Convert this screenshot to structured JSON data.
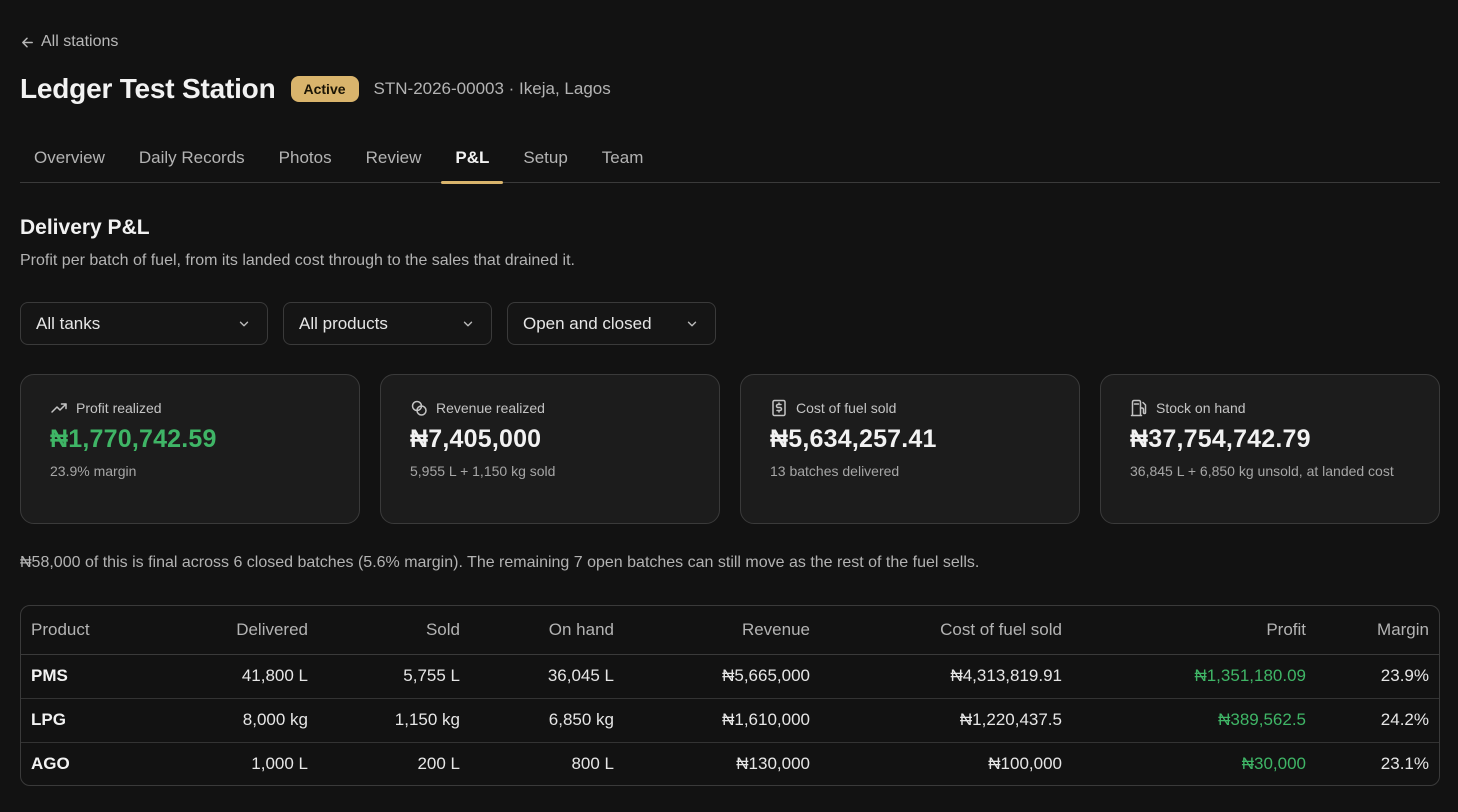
{
  "nav": {
    "back_label": "All stations"
  },
  "station": {
    "name": "Ledger Test Station",
    "status": "Active",
    "meta": "STN-2026-00003 · Ikeja, Lagos"
  },
  "tabs": [
    {
      "label": "Overview",
      "active": false
    },
    {
      "label": "Daily Records",
      "active": false
    },
    {
      "label": "Photos",
      "active": false
    },
    {
      "label": "Review",
      "active": false
    },
    {
      "label": "P&L",
      "active": true
    },
    {
      "label": "Setup",
      "active": false
    },
    {
      "label": "Team",
      "active": false
    }
  ],
  "section": {
    "title": "Delivery P&L",
    "description": "Profit per batch of fuel, from its landed cost through to the sales that drained it."
  },
  "filters": {
    "tank": "All tanks",
    "product": "All products",
    "status": "Open and closed"
  },
  "cards": [
    {
      "label": "Profit realized",
      "icon": "trending-up-icon",
      "value": "₦1,770,742.59",
      "sub": "23.9% margin",
      "positive": true
    },
    {
      "label": "Revenue realized",
      "icon": "coins-icon",
      "value": "₦7,405,000",
      "sub": "5,955 L + 1,150 kg sold",
      "positive": false
    },
    {
      "label": "Cost of fuel sold",
      "icon": "receipt-icon",
      "value": "₦5,634,257.41",
      "sub": "13 batches delivered",
      "positive": false
    },
    {
      "label": "Stock on hand",
      "icon": "fuel-pump-icon",
      "value": "₦37,754,742.79",
      "sub": "36,845 L + 6,850 kg unsold, at landed cost",
      "positive": false
    }
  ],
  "note": "₦58,000 of this is final across 6 closed batches (5.6% margin). The remaining 7 open batches can still move as the rest of the fuel sells.",
  "table": {
    "columns": [
      "Product",
      "Delivered",
      "Sold",
      "On hand",
      "Revenue",
      "Cost of fuel sold",
      "Profit",
      "Margin"
    ],
    "rows": [
      {
        "product": "PMS",
        "delivered": "41,800 L",
        "sold": "5,755 L",
        "on_hand": "36,045 L",
        "revenue": "₦5,665,000",
        "cost": "₦4,313,819.91",
        "profit": "₦1,351,180.09",
        "margin": "23.9%"
      },
      {
        "product": "LPG",
        "delivered": "8,000 kg",
        "sold": "1,150 kg",
        "on_hand": "6,850 kg",
        "revenue": "₦1,610,000",
        "cost": "₦1,220,437.5",
        "profit": "₦389,562.5",
        "margin": "24.2%"
      },
      {
        "product": "AGO",
        "delivered": "1,000 L",
        "sold": "200 L",
        "on_hand": "800 L",
        "revenue": "₦130,000",
        "cost": "₦100,000",
        "profit": "₦30,000",
        "margin": "23.1%"
      }
    ]
  },
  "colors": {
    "accent": "#d9b46c",
    "positive": "#3fb566",
    "background": "#121212"
  }
}
